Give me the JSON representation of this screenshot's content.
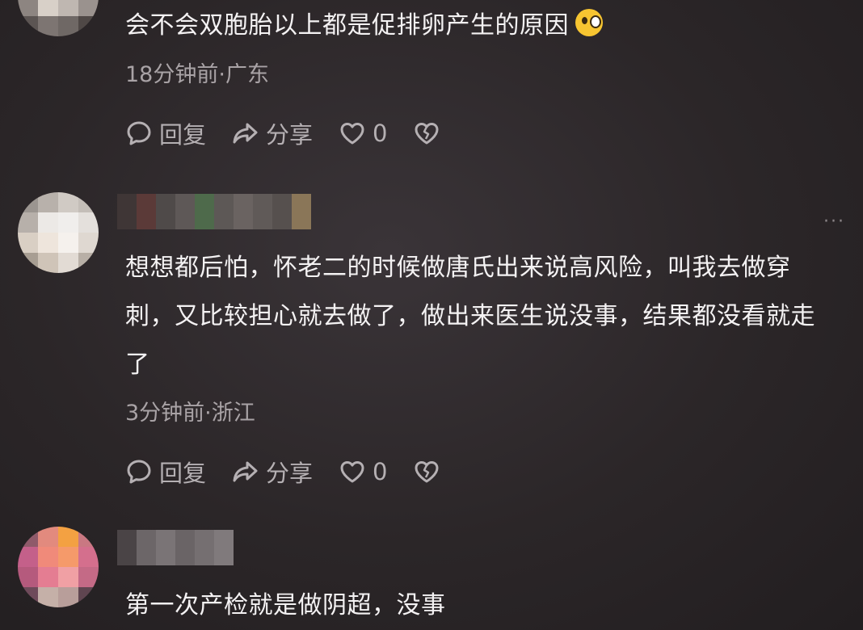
{
  "comments": [
    {
      "text": "会不会双胞胎以上都是促排卵产生的原因",
      "emoji": "惊吓表情",
      "meta": "18分钟前·广东",
      "reply_label": "回复",
      "share_label": "分享",
      "like_count": "0"
    },
    {
      "text": "想想都后怕，怀老二的时候做唐氏出来说高风险，叫我去做穿刺，又比较担心就去做了，做出来医生说没事，结果都没看就走了",
      "meta": "3分钟前·浙江",
      "reply_label": "回复",
      "share_label": "分享",
      "like_count": "0",
      "more": "···"
    },
    {
      "text": "第一次产检就是做阴超，没事"
    }
  ],
  "icons": [
    "comment-bubble-icon",
    "share-arrow-icon",
    "heart-icon",
    "broken-heart-icon",
    "more-icon"
  ],
  "colors": {
    "background": "#2b2628",
    "text": "#f4f2f3",
    "meta": "#a9a3a6",
    "action": "#b5b0b3"
  }
}
